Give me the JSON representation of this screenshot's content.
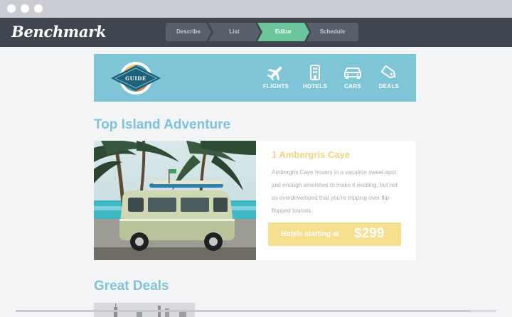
{
  "header": {
    "logo": "Benchmark",
    "steps": [
      "Describe",
      "List",
      "Editor",
      "Schedule"
    ],
    "active_step": "Editor"
  },
  "banner": {
    "logo_text": "GUIDE",
    "nav": [
      {
        "label": "FLIGHTS",
        "icon": "plane-icon"
      },
      {
        "label": "HOTELS",
        "icon": "hotel-icon"
      },
      {
        "label": "CARS",
        "icon": "car-icon"
      },
      {
        "label": "DEALS",
        "icon": "tag-icon"
      }
    ]
  },
  "section1": {
    "title": "Top Island Adventure",
    "place": "1 Ambergris Caye",
    "description": "Ambergris Caye hovers in a vacation sweet spot: just enough amenities to make it exciting, but not so overdeveloped that you're tripping over flip-flopped tourists.",
    "cta_text": "Hotels starting at",
    "cta_price": "$299"
  },
  "section2": {
    "title": "Great Deals"
  },
  "colors": {
    "header_bg": "#3f4650",
    "active_step": "#6cc69b",
    "banner": "#7fc5d8",
    "heading": "#80c2d8",
    "accent_yellow": "#f1d57e",
    "cta_bg": "#f6df8f"
  }
}
